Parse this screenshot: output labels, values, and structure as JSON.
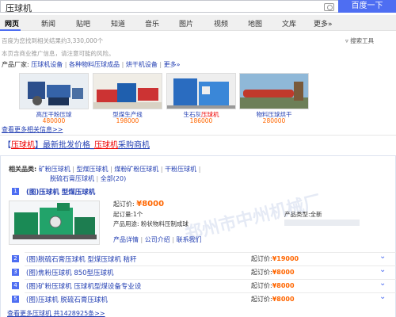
{
  "search": {
    "query": "压球机",
    "button": "百度一下"
  },
  "tabs": [
    "网页",
    "新闻",
    "贴吧",
    "知道",
    "音乐",
    "图片",
    "视频",
    "地图",
    "文库",
    "更多»"
  ],
  "result_count": "百度为您找到相关结果约3,330,000个",
  "search_tools": "搜索工具",
  "promo_notice": "本页含商业推广信息，请注意可能的风险。",
  "vendors": {
    "label": "产品厂家:",
    "links": [
      "压球机设备",
      "各种物料压球成品",
      "烘干机设备",
      "更多»"
    ]
  },
  "products": [
    {
      "name": "高压干粉压球",
      "price": "480000"
    },
    {
      "name": "型煤生产线",
      "price": "198000"
    },
    {
      "name": "生石灰压球机",
      "name_pre": "生石灰",
      "name_hl": "压球机",
      "price": "186000"
    },
    {
      "name": "物料压球烘干",
      "price": "280000"
    }
  ],
  "more_info": "查看更多相关信息>>",
  "b2b": {
    "headline_pre": "【",
    "headline_hl1": "压球机",
    "headline_mid": "】最新批发价格_",
    "headline_hl2": "压球机",
    "headline_post": "采购商机",
    "related_label": "相关品类:",
    "related_row1": [
      "矿粉压球机",
      "型煤压球机",
      "煤粉矿粉压球机",
      "干粉压球机"
    ],
    "related_row2": [
      "脱硫石膏压球机",
      "全部(20)"
    ],
    "main_item": {
      "num": "1",
      "title": "(图)压球机 型煤压球机",
      "price_label": "起订价:",
      "price": "¥8000",
      "moq_label": "起订量:",
      "moq": "1个",
      "usage_label": "产品用途:",
      "usage": "粉状物料压制成球",
      "type_label": "产品类型:",
      "type": "全新",
      "actions": [
        "产品详情",
        "公司介绍",
        "联系我们"
      ]
    },
    "items": [
      {
        "num": "2",
        "title": "(图)脱硫石膏压球机 型煤压球机 秸秆",
        "price_label": "起订价:",
        "price": "¥19000"
      },
      {
        "num": "3",
        "title": "(图)焦粉压球机 850型压球机",
        "price_label": "起订价:",
        "price": "¥8000"
      },
      {
        "num": "4",
        "title": "(图)矿粉压球机 压球机型煤设备专业设",
        "price_label": "起订价:",
        "price": "¥8000"
      },
      {
        "num": "5",
        "title": "(图)压球机 脱硫石膏压球机",
        "price_label": "起订价:",
        "price": "¥8000"
      }
    ],
    "more": "查看更多压球机 共1428925条>>",
    "watermark": "郑州市中州机械厂"
  },
  "colors": {
    "accent": "#4e6ef2",
    "price": "#f60",
    "highlight": "#e00",
    "link": "#2440b3"
  }
}
